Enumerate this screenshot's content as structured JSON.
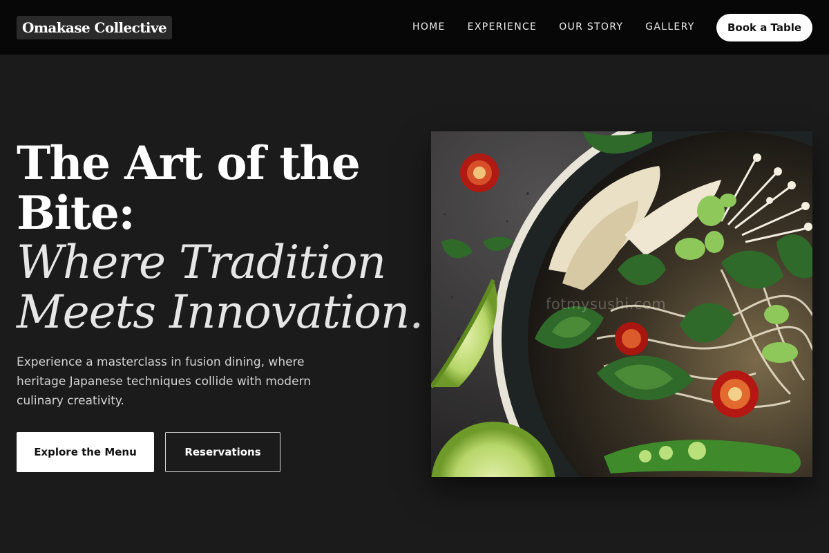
{
  "header": {
    "logo": "Omakase Collective",
    "nav": [
      "HOME",
      "EXPERIENCE",
      "OUR STORY",
      "GALLERY"
    ],
    "cta": "Book a Table"
  },
  "hero": {
    "title_line1": "The Art of the",
    "title_line2": "Bite:",
    "subtitle_line1": "Where Tradition",
    "subtitle_line2": "Meets Innovation.",
    "description": "Experience a masterclass in fusion dining, where heritage Japanese techniques collide with modern culinary creativity.",
    "primary_button": "Explore the Menu",
    "secondary_button": "Reservations",
    "image_watermark": "fotmysushi.com"
  },
  "colors": {
    "background": "#1b1b1b",
    "topbar": "#070707",
    "button_bg": "#ffffff",
    "text": "#ffffff"
  },
  "icons": {
    "hero_image": "noodle-bowl-photo"
  }
}
